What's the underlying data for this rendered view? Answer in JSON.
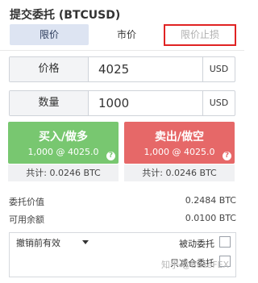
{
  "header": {
    "title": "提交委托 (BTCUSD)"
  },
  "tabs": [
    {
      "label": "限价",
      "active": true
    },
    {
      "label": "市价",
      "active": false
    },
    {
      "label": "限价止损",
      "active": false,
      "disabled": true
    }
  ],
  "price": {
    "label": "价格",
    "value": "4025",
    "unit": "USD"
  },
  "quantity": {
    "label": "数量",
    "value": "1000",
    "unit": "USD"
  },
  "buy": {
    "label": "买入/做多",
    "sub": "1,000 @ 4025.0",
    "total": "共计: 0.0246 BTC",
    "color": "#78c770"
  },
  "sell": {
    "label": "卖出/做空",
    "sub": "1,000 @ 4025.0",
    "total": "共计: 0.0246 BTC",
    "color": "#e66868"
  },
  "info": {
    "order_value_label": "委托价值",
    "order_value": "0.2484 BTC",
    "balance_label": "可用余额",
    "balance": "0.0100 BTC"
  },
  "options": {
    "time_in_force": "撤销前有效",
    "post_only_label": "被动委托",
    "reduce_only_label": "只减仓委托"
  },
  "watermark": "知乎 @BaseFEX",
  "colors": {
    "highlight_box": "#e02323",
    "active_tab_bg": "#dde4f2"
  }
}
